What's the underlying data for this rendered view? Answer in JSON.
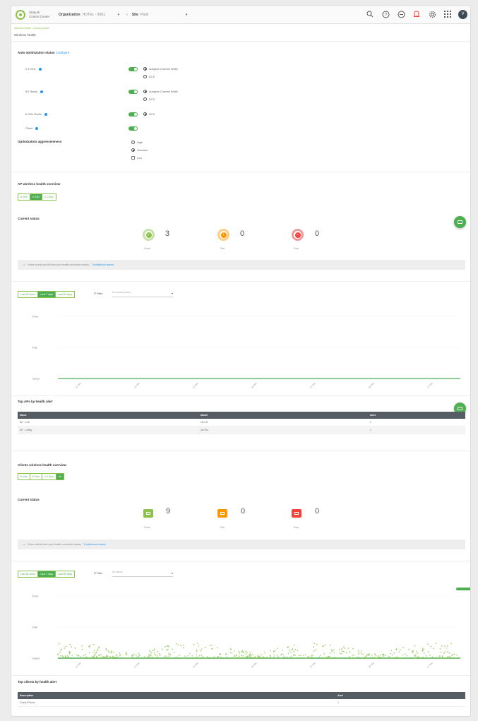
{
  "header": {
    "brand_line1": "Ubiquiti",
    "brand_line2": "Control Center",
    "org_label": "Organization",
    "org_value": "HOTEL - 0001",
    "site_label": "Site",
    "site_value": "Paris",
    "avatar_letter": "V"
  },
  "breadcrumb": {
    "path": "Wireless health > Access points",
    "current": "Wireless health"
  },
  "page_title": "Wireless health",
  "auto_opt": {
    "title": "Auto optimization status",
    "link": "Configure",
    "rows": [
      {
        "label": "2.4 GHz",
        "options": [
          "Adaptive Channel Width",
          "DCS"
        ]
      },
      {
        "label": "5G Radio",
        "options": [
          "Adaptive Channel Width",
          "DCS"
        ]
      },
      {
        "label": "5 GHz Radio",
        "options": [
          "DCS"
        ]
      },
      {
        "label": "Client",
        "options": []
      }
    ],
    "aggr_title": "Optimization aggressiveness",
    "aggr_options": [
      "High",
      "Standard",
      "Low"
    ]
  },
  "ap_overview": {
    "title": "AP wireless health overview",
    "bands": [
      "6 GHz",
      "5 GHz",
      "2.4 GHz"
    ],
    "status_title": "Current status",
    "good": "3",
    "fair": "0",
    "poor": "0",
    "good_label": "Good",
    "fair_label": "Fair",
    "poor_label": "Poor",
    "note": "Some access points have poor health connection status.",
    "note_link": "Troubleshoot issues"
  },
  "ap_chart_ctrl": {
    "ranges": [
      "Last 24 hours",
      "Last 7 days",
      "Last 30 days"
    ],
    "filter_label": "Filter",
    "filter_placeholder": "All access points"
  },
  "chart_ap": {
    "type": "line",
    "y_categories": [
      "Poor",
      "Fair",
      "Good"
    ],
    "x_ticks": [
      "11 Mar",
      "12 Mar",
      "13 Mar",
      "14 Mar",
      "15 Mar",
      "16 Mar",
      "17 Mar"
    ],
    "series": [
      {
        "values": [
          "Good",
          "Good",
          "Good",
          "Good",
          "Good",
          "Good",
          "Good"
        ]
      }
    ]
  },
  "top_aps": {
    "title": "Top APs by health alert",
    "columns": [
      "Name",
      "Model",
      "Alert"
    ],
    "rows": [
      [
        "AP - Loft",
        "U6-LR",
        "1"
      ],
      [
        "AP - Lobby",
        "U6-Pro",
        "1"
      ]
    ]
  },
  "clients_overview": {
    "title": "Clients wireless health overview",
    "bands": [
      "6 GHz",
      "5 GHz",
      "2.4 GHz",
      "All"
    ],
    "status_title": "Current status",
    "good": "9",
    "fair": "0",
    "poor": "0",
    "good_label": "Good",
    "fair_label": "Fair",
    "poor_label": "Poor",
    "note": "Some clients have poor health connection status.",
    "note_link": "Troubleshoot issues"
  },
  "cl_chart_ctrl": {
    "ranges": [
      "Last 24 hours",
      "Last 7 days",
      "Last 30 days"
    ],
    "filter_label": "Filter",
    "filter_placeholder": "All clients"
  },
  "chart_clients": {
    "type": "scatter",
    "y_categories": [
      "Poor",
      "Fair",
      "Good"
    ],
    "x_ticks": [
      "11 Mar",
      "12 Mar",
      "13 Mar",
      "14 Mar",
      "15 Mar",
      "16 Mar",
      "17 Mar"
    ]
  },
  "top_clients": {
    "title": "Top clients by health alert",
    "columns": [
      "Description",
      "Alert"
    ],
    "rows": [
      [
        "Guest-iPhone",
        "1"
      ]
    ]
  },
  "colors": {
    "good": "#8bc34a",
    "fair": "#ff9800",
    "poor": "#f44336",
    "accent": "#4caf50"
  }
}
